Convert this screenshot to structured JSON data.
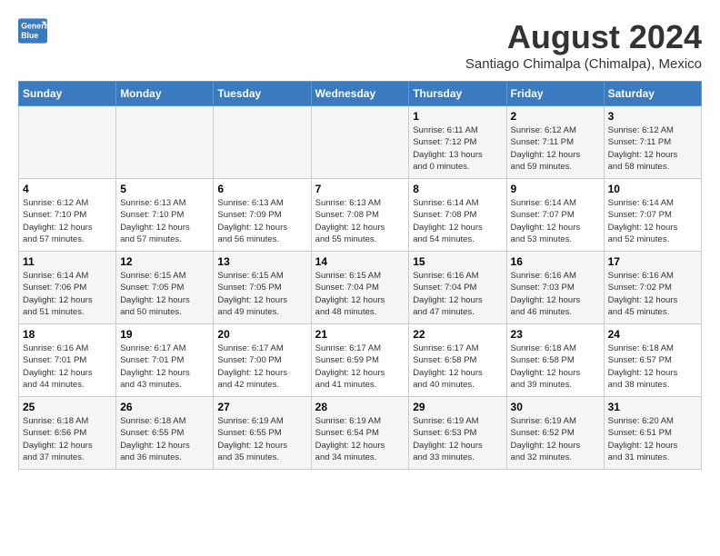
{
  "header": {
    "logo_line1": "General",
    "logo_line2": "Blue",
    "month_title": "August 2024",
    "subtitle": "Santiago Chimalpa (Chimalpa), Mexico"
  },
  "weekdays": [
    "Sunday",
    "Monday",
    "Tuesday",
    "Wednesday",
    "Thursday",
    "Friday",
    "Saturday"
  ],
  "weeks": [
    [
      {
        "day": "",
        "info": ""
      },
      {
        "day": "",
        "info": ""
      },
      {
        "day": "",
        "info": ""
      },
      {
        "day": "",
        "info": ""
      },
      {
        "day": "1",
        "info": "Sunrise: 6:11 AM\nSunset: 7:12 PM\nDaylight: 13 hours\nand 0 minutes."
      },
      {
        "day": "2",
        "info": "Sunrise: 6:12 AM\nSunset: 7:11 PM\nDaylight: 12 hours\nand 59 minutes."
      },
      {
        "day": "3",
        "info": "Sunrise: 6:12 AM\nSunset: 7:11 PM\nDaylight: 12 hours\nand 58 minutes."
      }
    ],
    [
      {
        "day": "4",
        "info": "Sunrise: 6:12 AM\nSunset: 7:10 PM\nDaylight: 12 hours\nand 57 minutes."
      },
      {
        "day": "5",
        "info": "Sunrise: 6:13 AM\nSunset: 7:10 PM\nDaylight: 12 hours\nand 57 minutes."
      },
      {
        "day": "6",
        "info": "Sunrise: 6:13 AM\nSunset: 7:09 PM\nDaylight: 12 hours\nand 56 minutes."
      },
      {
        "day": "7",
        "info": "Sunrise: 6:13 AM\nSunset: 7:08 PM\nDaylight: 12 hours\nand 55 minutes."
      },
      {
        "day": "8",
        "info": "Sunrise: 6:14 AM\nSunset: 7:08 PM\nDaylight: 12 hours\nand 54 minutes."
      },
      {
        "day": "9",
        "info": "Sunrise: 6:14 AM\nSunset: 7:07 PM\nDaylight: 12 hours\nand 53 minutes."
      },
      {
        "day": "10",
        "info": "Sunrise: 6:14 AM\nSunset: 7:07 PM\nDaylight: 12 hours\nand 52 minutes."
      }
    ],
    [
      {
        "day": "11",
        "info": "Sunrise: 6:14 AM\nSunset: 7:06 PM\nDaylight: 12 hours\nand 51 minutes."
      },
      {
        "day": "12",
        "info": "Sunrise: 6:15 AM\nSunset: 7:05 PM\nDaylight: 12 hours\nand 50 minutes."
      },
      {
        "day": "13",
        "info": "Sunrise: 6:15 AM\nSunset: 7:05 PM\nDaylight: 12 hours\nand 49 minutes."
      },
      {
        "day": "14",
        "info": "Sunrise: 6:15 AM\nSunset: 7:04 PM\nDaylight: 12 hours\nand 48 minutes."
      },
      {
        "day": "15",
        "info": "Sunrise: 6:16 AM\nSunset: 7:04 PM\nDaylight: 12 hours\nand 47 minutes."
      },
      {
        "day": "16",
        "info": "Sunrise: 6:16 AM\nSunset: 7:03 PM\nDaylight: 12 hours\nand 46 minutes."
      },
      {
        "day": "17",
        "info": "Sunrise: 6:16 AM\nSunset: 7:02 PM\nDaylight: 12 hours\nand 45 minutes."
      }
    ],
    [
      {
        "day": "18",
        "info": "Sunrise: 6:16 AM\nSunset: 7:01 PM\nDaylight: 12 hours\nand 44 minutes."
      },
      {
        "day": "19",
        "info": "Sunrise: 6:17 AM\nSunset: 7:01 PM\nDaylight: 12 hours\nand 43 minutes."
      },
      {
        "day": "20",
        "info": "Sunrise: 6:17 AM\nSunset: 7:00 PM\nDaylight: 12 hours\nand 42 minutes."
      },
      {
        "day": "21",
        "info": "Sunrise: 6:17 AM\nSunset: 6:59 PM\nDaylight: 12 hours\nand 41 minutes."
      },
      {
        "day": "22",
        "info": "Sunrise: 6:17 AM\nSunset: 6:58 PM\nDaylight: 12 hours\nand 40 minutes."
      },
      {
        "day": "23",
        "info": "Sunrise: 6:18 AM\nSunset: 6:58 PM\nDaylight: 12 hours\nand 39 minutes."
      },
      {
        "day": "24",
        "info": "Sunrise: 6:18 AM\nSunset: 6:57 PM\nDaylight: 12 hours\nand 38 minutes."
      }
    ],
    [
      {
        "day": "25",
        "info": "Sunrise: 6:18 AM\nSunset: 6:56 PM\nDaylight: 12 hours\nand 37 minutes."
      },
      {
        "day": "26",
        "info": "Sunrise: 6:18 AM\nSunset: 6:55 PM\nDaylight: 12 hours\nand 36 minutes."
      },
      {
        "day": "27",
        "info": "Sunrise: 6:19 AM\nSunset: 6:55 PM\nDaylight: 12 hours\nand 35 minutes."
      },
      {
        "day": "28",
        "info": "Sunrise: 6:19 AM\nSunset: 6:54 PM\nDaylight: 12 hours\nand 34 minutes."
      },
      {
        "day": "29",
        "info": "Sunrise: 6:19 AM\nSunset: 6:53 PM\nDaylight: 12 hours\nand 33 minutes."
      },
      {
        "day": "30",
        "info": "Sunrise: 6:19 AM\nSunset: 6:52 PM\nDaylight: 12 hours\nand 32 minutes."
      },
      {
        "day": "31",
        "info": "Sunrise: 6:20 AM\nSunset: 6:51 PM\nDaylight: 12 hours\nand 31 minutes."
      }
    ]
  ]
}
